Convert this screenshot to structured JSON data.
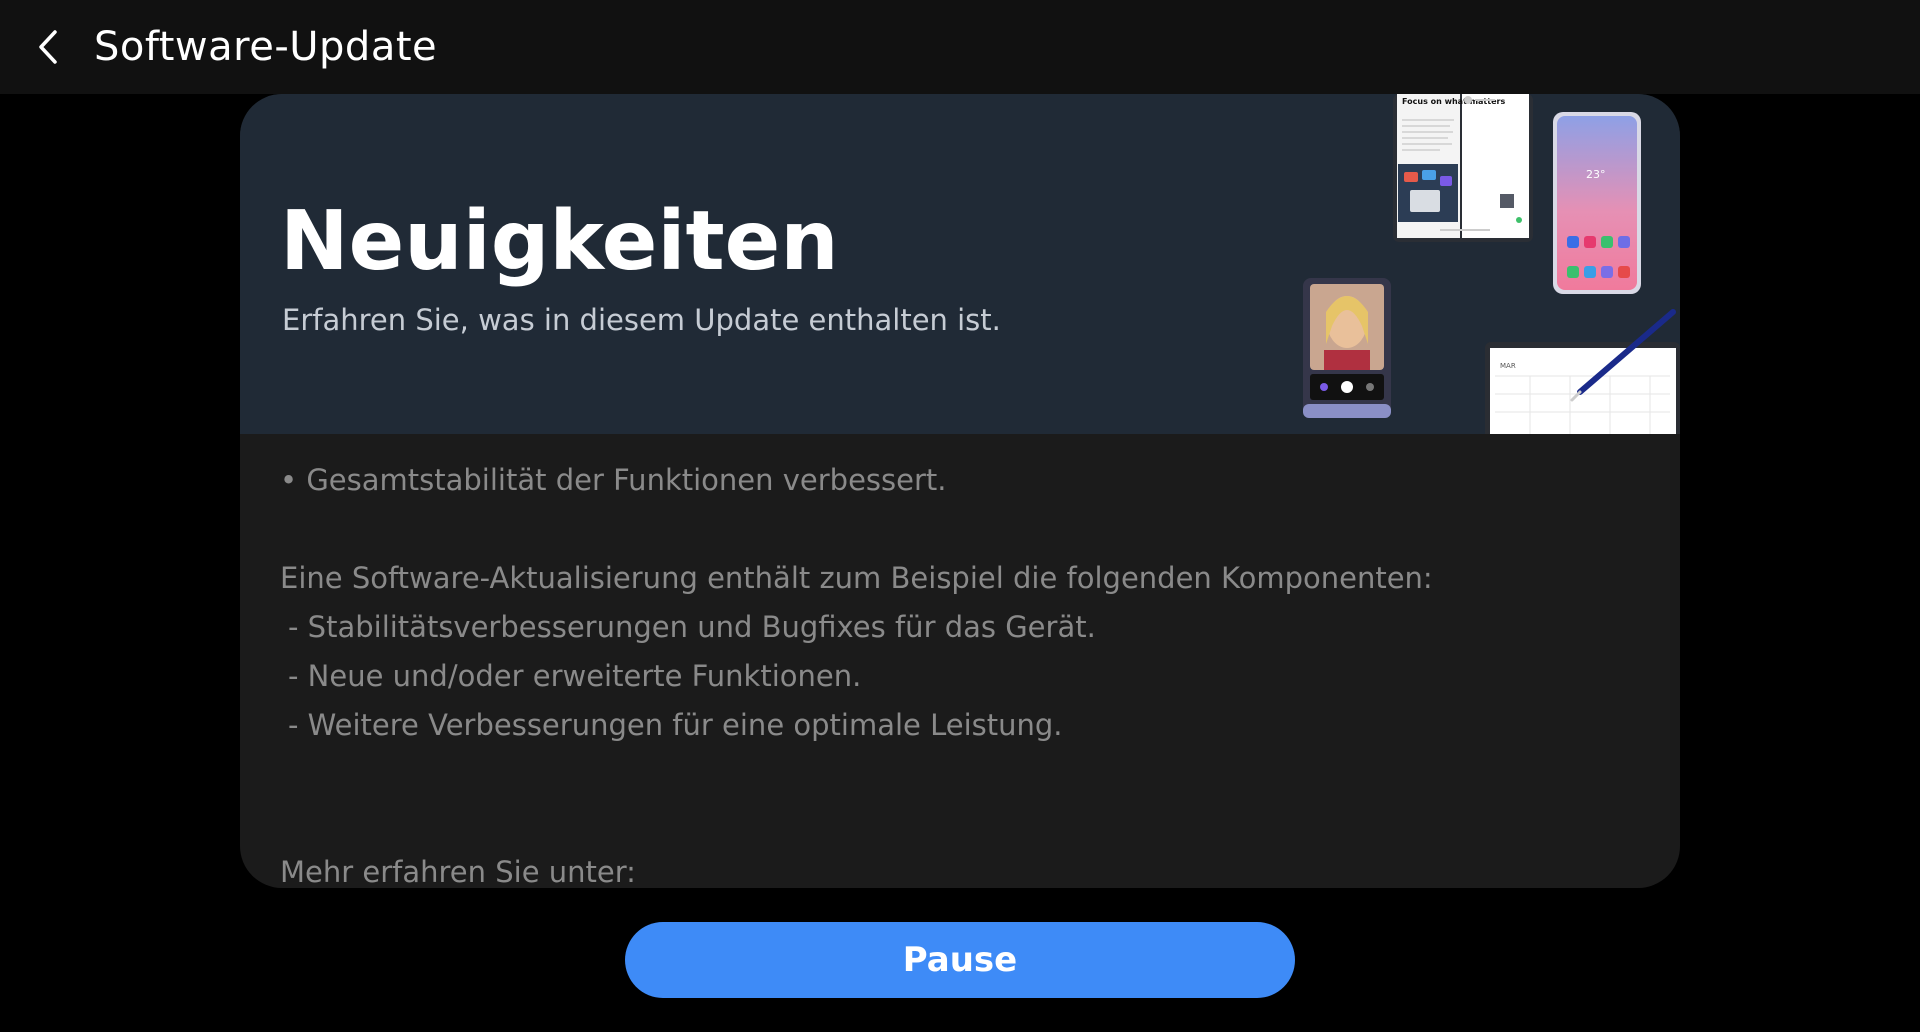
{
  "header": {
    "title": "Software-Update",
    "back_icon": "chevron-left-icon"
  },
  "hero": {
    "title": "Neuigkeiten",
    "subtitle": "Erfahren Sie, was in diesem Update enthalten ist.",
    "phone_screen_heading": "Focus on what matters",
    "phone_clock": "23°",
    "calendar_month": "MAR"
  },
  "notes": {
    "bullet": "• Gesamtstabilität der Funktionen verbessert.",
    "intro": "Eine Software-Aktualisierung enthält zum Beispiel die folgenden Komponenten:",
    "items": [
      "- Stabilitätsverbesserungen und Bugfixes für das Gerät.",
      "- Neue und/oder erweiterte Funktionen.",
      "- Weitere Verbesserungen für eine optimale Leistung."
    ],
    "more": "Mehr erfahren Sie unter:"
  },
  "actions": {
    "pause_label": "Pause"
  },
  "colors": {
    "background": "#000000",
    "topbar": "#111111",
    "card": "#1b1b1b",
    "hero": "#202a36",
    "accent": "#3e8bf7",
    "body_text": "#8a8a8a"
  }
}
